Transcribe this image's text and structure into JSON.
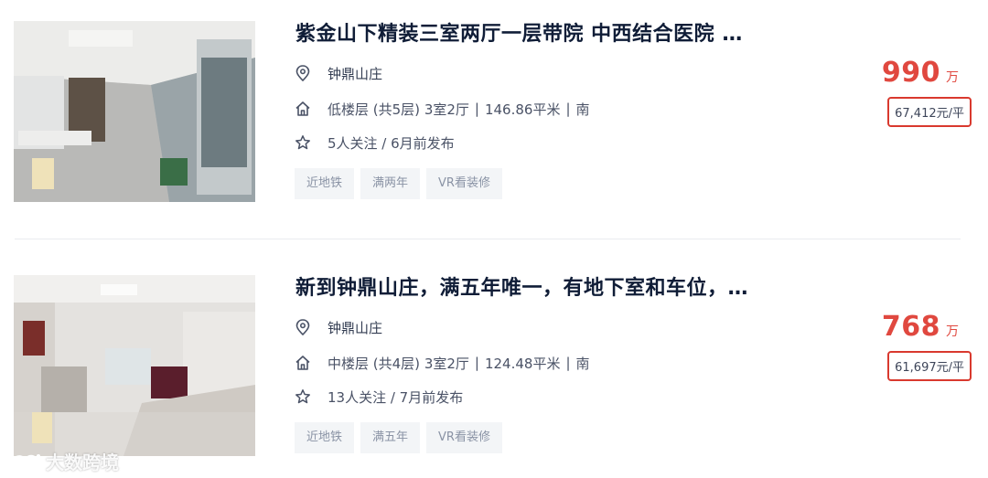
{
  "listings": [
    {
      "title": "紫金山下精装三室两厅一层带院 中西结合医院 …",
      "community": "钟鼎山庄",
      "floor": "低楼层 (共5层)",
      "layout": "3室2厅",
      "area": "146.86平米",
      "orientation": "南",
      "separator": "|",
      "follow": "5人关注 / 6月前发布",
      "tags": [
        "近地铁",
        "满两年",
        "VR看装修"
      ],
      "price": "990",
      "price_unit": "万",
      "unit_price": "67,412元/平"
    },
    {
      "title": "新到钟鼎山庄，满五年唯一，有地下室和车位，…",
      "community": "钟鼎山庄",
      "floor": "中楼层 (共4层)",
      "layout": "3室2厅",
      "area": "124.48平米",
      "orientation": "南",
      "separator": "|",
      "follow": "13人关注 / 7月前发布",
      "tags": [
        "近地铁",
        "满五年",
        "VR看装修"
      ],
      "price": "768",
      "price_unit": "万",
      "unit_price": "61,697元/平"
    }
  ],
  "watermark": {
    "text": "大数跨境",
    "icon": "brand-logo-icon"
  },
  "colors": {
    "price": "#e0483f",
    "highlight_box": "#d9392e",
    "tag_bg": "#f3f5f7"
  },
  "icons": {
    "location": "location-pin-icon",
    "house": "house-icon",
    "star": "star-icon"
  }
}
